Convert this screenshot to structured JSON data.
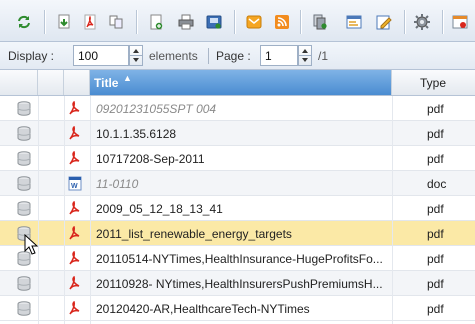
{
  "toolbar": {
    "buttons": [
      {
        "name": "refresh-icon"
      },
      {
        "name": "download-icon"
      },
      {
        "name": "pdf-export-icon"
      },
      {
        "name": "copy-icon"
      },
      {
        "name": "new-document-icon"
      },
      {
        "name": "print-icon"
      },
      {
        "name": "save-icon"
      },
      {
        "name": "email-icon"
      },
      {
        "name": "rss-icon"
      },
      {
        "name": "copy-document-icon"
      },
      {
        "name": "properties-icon"
      },
      {
        "name": "edit-icon"
      },
      {
        "name": "settings-gear-icon"
      },
      {
        "name": "delete-icon"
      }
    ]
  },
  "pager": {
    "display_label": "Display :",
    "display_value": "100",
    "elements_label": "elements",
    "page_label": "Page :",
    "page_value": "1",
    "total_pages": "/1"
  },
  "grid": {
    "columns": {
      "title": "Title",
      "type": "Type"
    },
    "sort_indicator": "▲",
    "rows": [
      {
        "title": "09201231055SPT 004",
        "type": "pdf",
        "icon": "pdf-icon",
        "greyed": true
      },
      {
        "title": "10.1.1.35.6128",
        "type": "pdf",
        "icon": "pdf-icon",
        "greyed": false
      },
      {
        "title": "10717208-Sep-2011",
        "type": "pdf",
        "icon": "pdf-icon",
        "greyed": false
      },
      {
        "title": "11-0110",
        "type": "doc",
        "icon": "word-doc-icon",
        "greyed": true
      },
      {
        "title": "2009_05_12_18_13_41",
        "type": "pdf",
        "icon": "pdf-icon",
        "greyed": false
      },
      {
        "title": "2011_list_renewable_energy_targets",
        "type": "pdf",
        "icon": "pdf-icon",
        "greyed": false,
        "selected": true
      },
      {
        "title": "20110514-NYTimes,HealthInsurance-HugeProfitsFo...",
        "type": "pdf",
        "icon": "pdf-icon",
        "greyed": false
      },
      {
        "title": "20110928- NYtimes,HealthInsurersPushPremiumsH...",
        "type": "pdf",
        "icon": "pdf-icon",
        "greyed": false
      },
      {
        "title": "20120420-AR,HealthcareTech-NYTimes",
        "type": "pdf",
        "icon": "pdf-icon",
        "greyed": false
      }
    ]
  },
  "colors": {
    "selected_row": "#fbe9a6",
    "header_sorted": "#4a8cd1",
    "pdf_red": "#d9261c"
  }
}
